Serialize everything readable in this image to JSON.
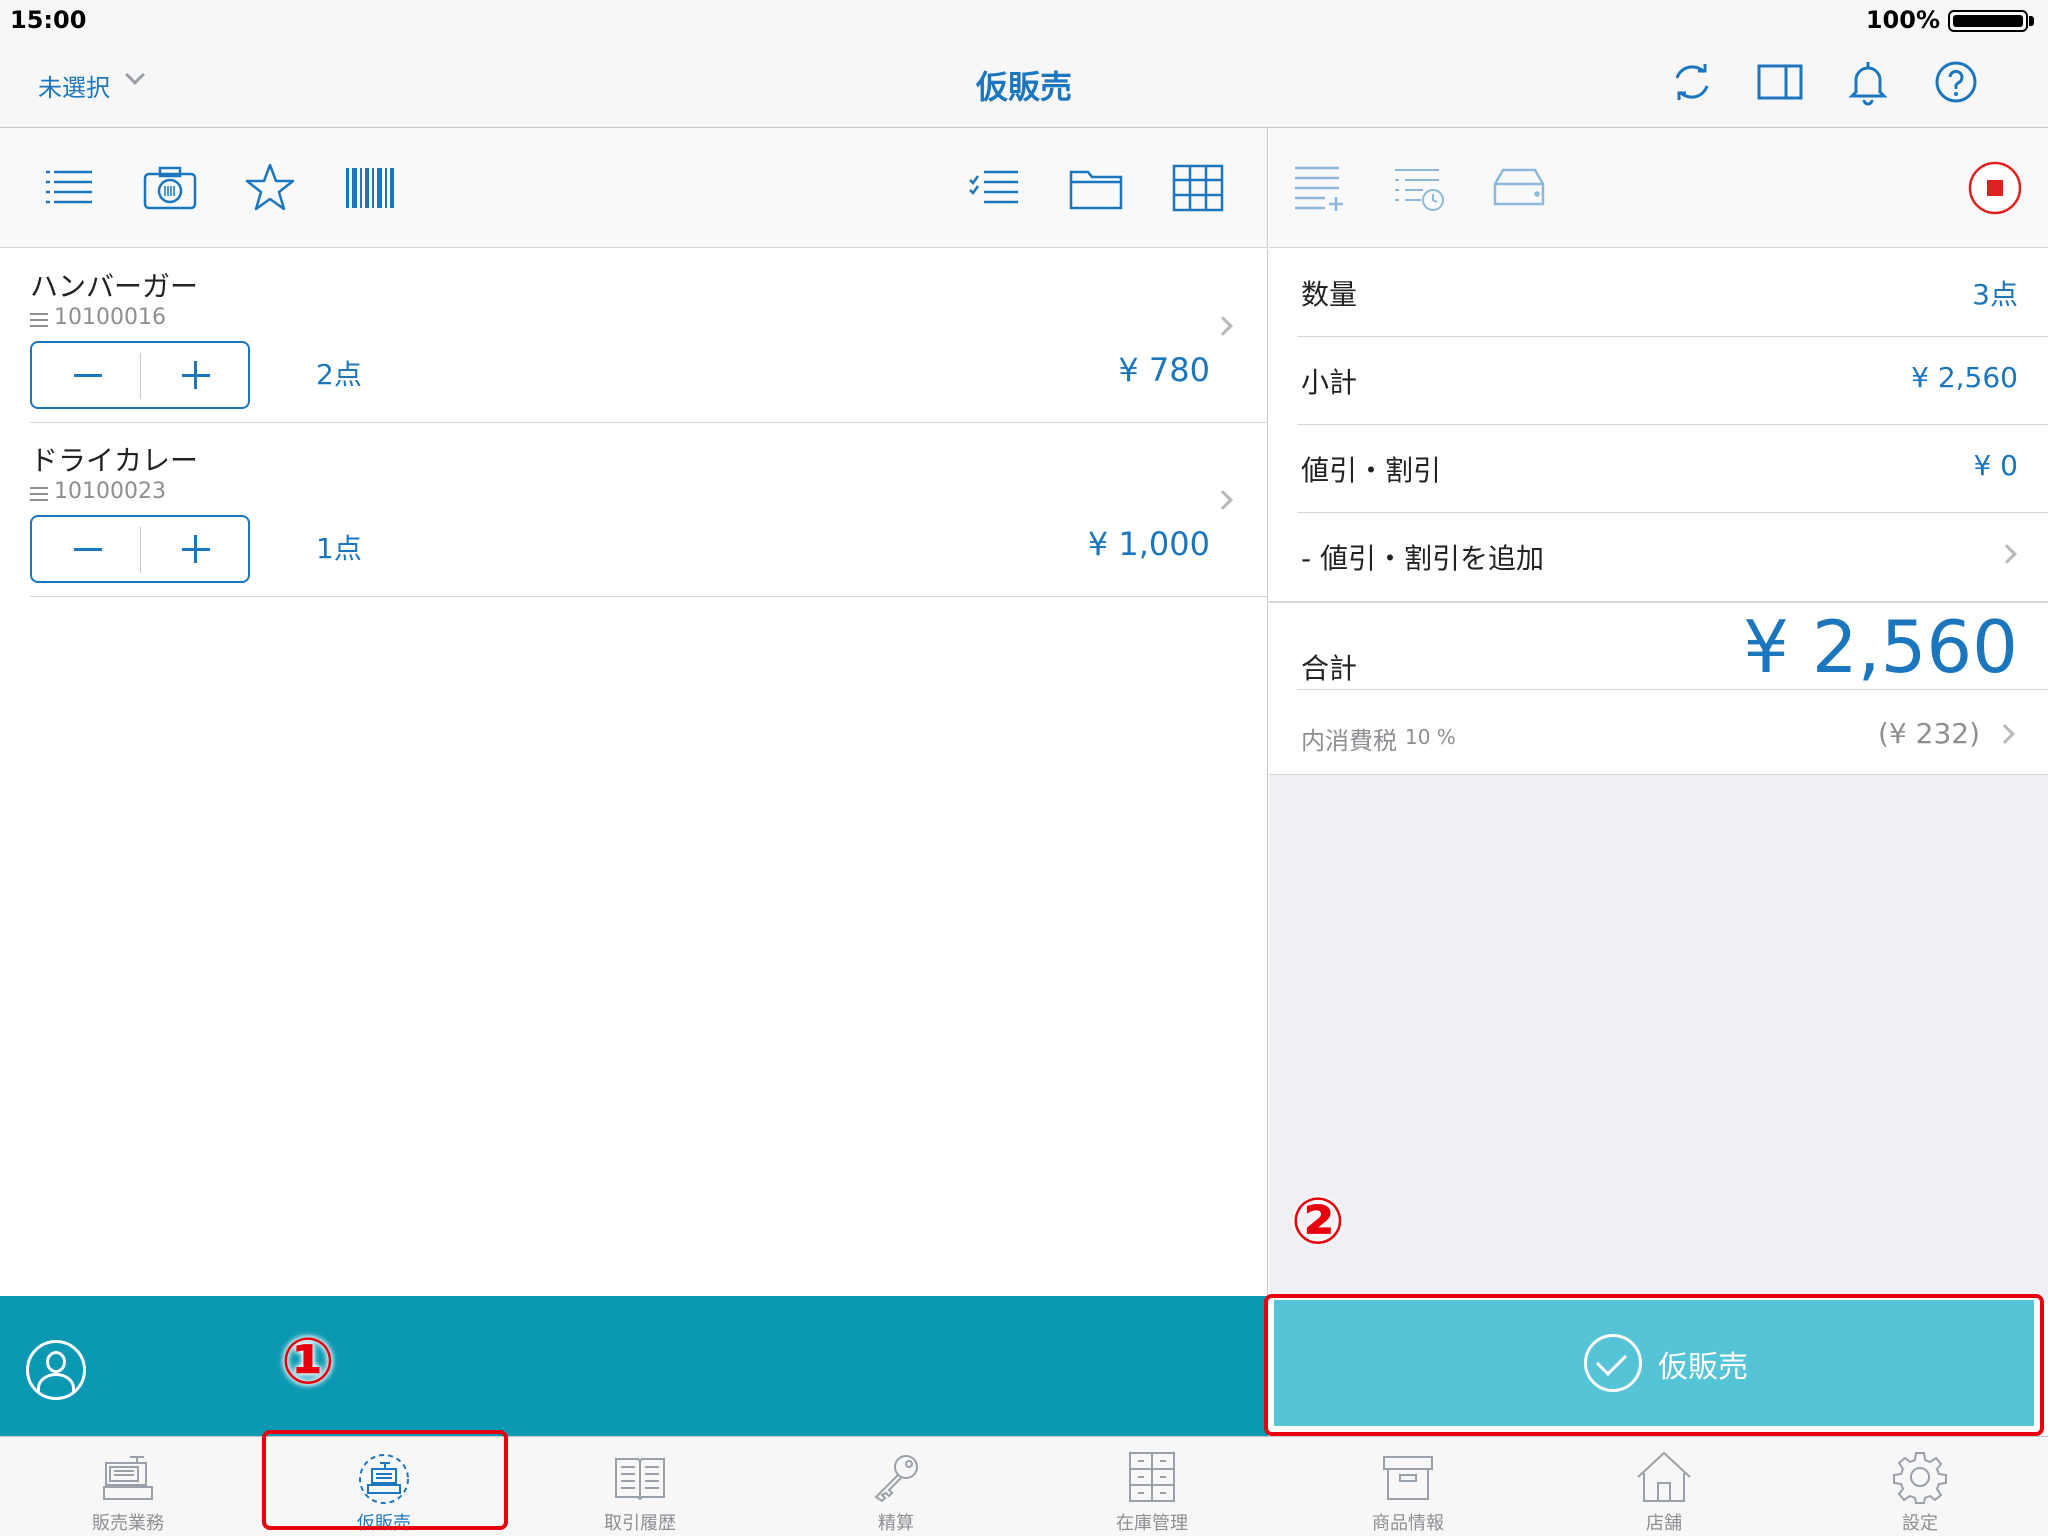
{
  "status_bar": {
    "time": "15:00",
    "battery": "100%"
  },
  "nav": {
    "store_selector": "未選択",
    "title": "仮販売"
  },
  "cart": {
    "items": [
      {
        "name": "ハンバーガー",
        "code": "10100016",
        "qty": "2点",
        "price": "¥ 780"
      },
      {
        "name": "ドライカレー",
        "code": "10100023",
        "qty": "1点",
        "price": "¥ 1,000"
      }
    ]
  },
  "summary": {
    "rows": [
      {
        "label": "数量",
        "value": "3点"
      },
      {
        "label": "小計",
        "value": "¥ 2,560"
      },
      {
        "label": "値引・割引",
        "value": "¥ 0"
      }
    ],
    "add_discount": "- 値引・割引を追加",
    "total_label": "合計",
    "total_value": "¥ 2,560",
    "tax_label": "内消費税",
    "tax_rate": "10 %",
    "tax_value": "(¥ 232)"
  },
  "checkout_button": "仮販売",
  "tabs": [
    {
      "label": "販売業務",
      "icon": "register-icon"
    },
    {
      "label": "仮販売",
      "icon": "provisional-register-icon"
    },
    {
      "label": "取引履歴",
      "icon": "history-book-icon"
    },
    {
      "label": "精算",
      "icon": "key-icon"
    },
    {
      "label": "在庫管理",
      "icon": "cabinet-icon"
    },
    {
      "label": "商品情報",
      "icon": "box-icon"
    },
    {
      "label": "店舗",
      "icon": "house-icon"
    },
    {
      "label": "設定",
      "icon": "gear-icon"
    }
  ],
  "annotations": {
    "one": "①",
    "two": "②"
  },
  "colors": {
    "accent": "#1b76bd",
    "teal": "#0a98b2",
    "checkout": "#55c4d6",
    "annotation": "#e8000d"
  }
}
